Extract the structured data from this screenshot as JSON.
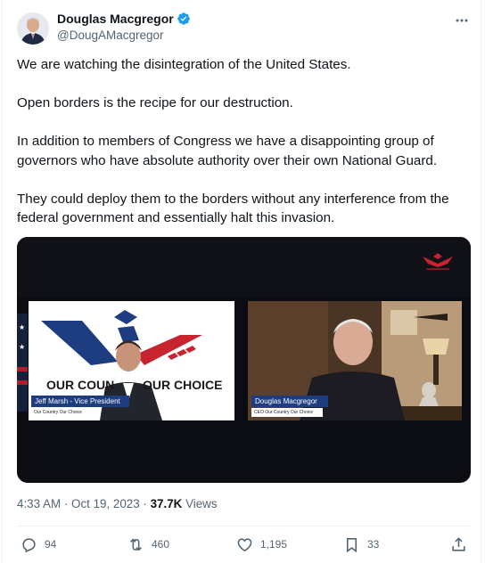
{
  "tweet": {
    "author": {
      "display_name": "Douglas Macgregor",
      "handle": "@DougAMacgregor",
      "verified": true
    },
    "paragraphs": [
      "We are watching the disintegration of the United States.",
      "Open borders is the recipe for our destruction.",
      "In addition to members of Congress we have a disappointing group of governors who have absolute authority over their own National Guard.",
      "They could deploy them to the borders without any interference from the federal government and essentially halt this invasion."
    ],
    "media": {
      "banner_text_left": "OUR COUN",
      "banner_text_right": "OUR CHOICE",
      "left_lower_third": "Jeff Marsh - Vice President",
      "left_sub": "Our Country Our Choice",
      "right_lower_third": "Douglas Macgregor",
      "right_sub": "CEO Our Country Our Choice"
    },
    "timestamp": "4:33 AM · Oct 19, 2023 · ",
    "views_count": "37.7K",
    "views_label": " Views"
  },
  "actions": {
    "replies": "94",
    "reposts": "460",
    "likes": "1,195",
    "bookmarks": "33"
  },
  "colors": {
    "verified_badge": "#1d9bf0",
    "secondary_text": "#536471",
    "primary_text": "#0f1419",
    "brand_red": "#c8242f",
    "brand_blue": "#1e3c80"
  },
  "icons": [
    "more-icon",
    "verified-icon",
    "reply-icon",
    "repost-icon",
    "like-icon",
    "bookmark-icon",
    "share-icon"
  ]
}
